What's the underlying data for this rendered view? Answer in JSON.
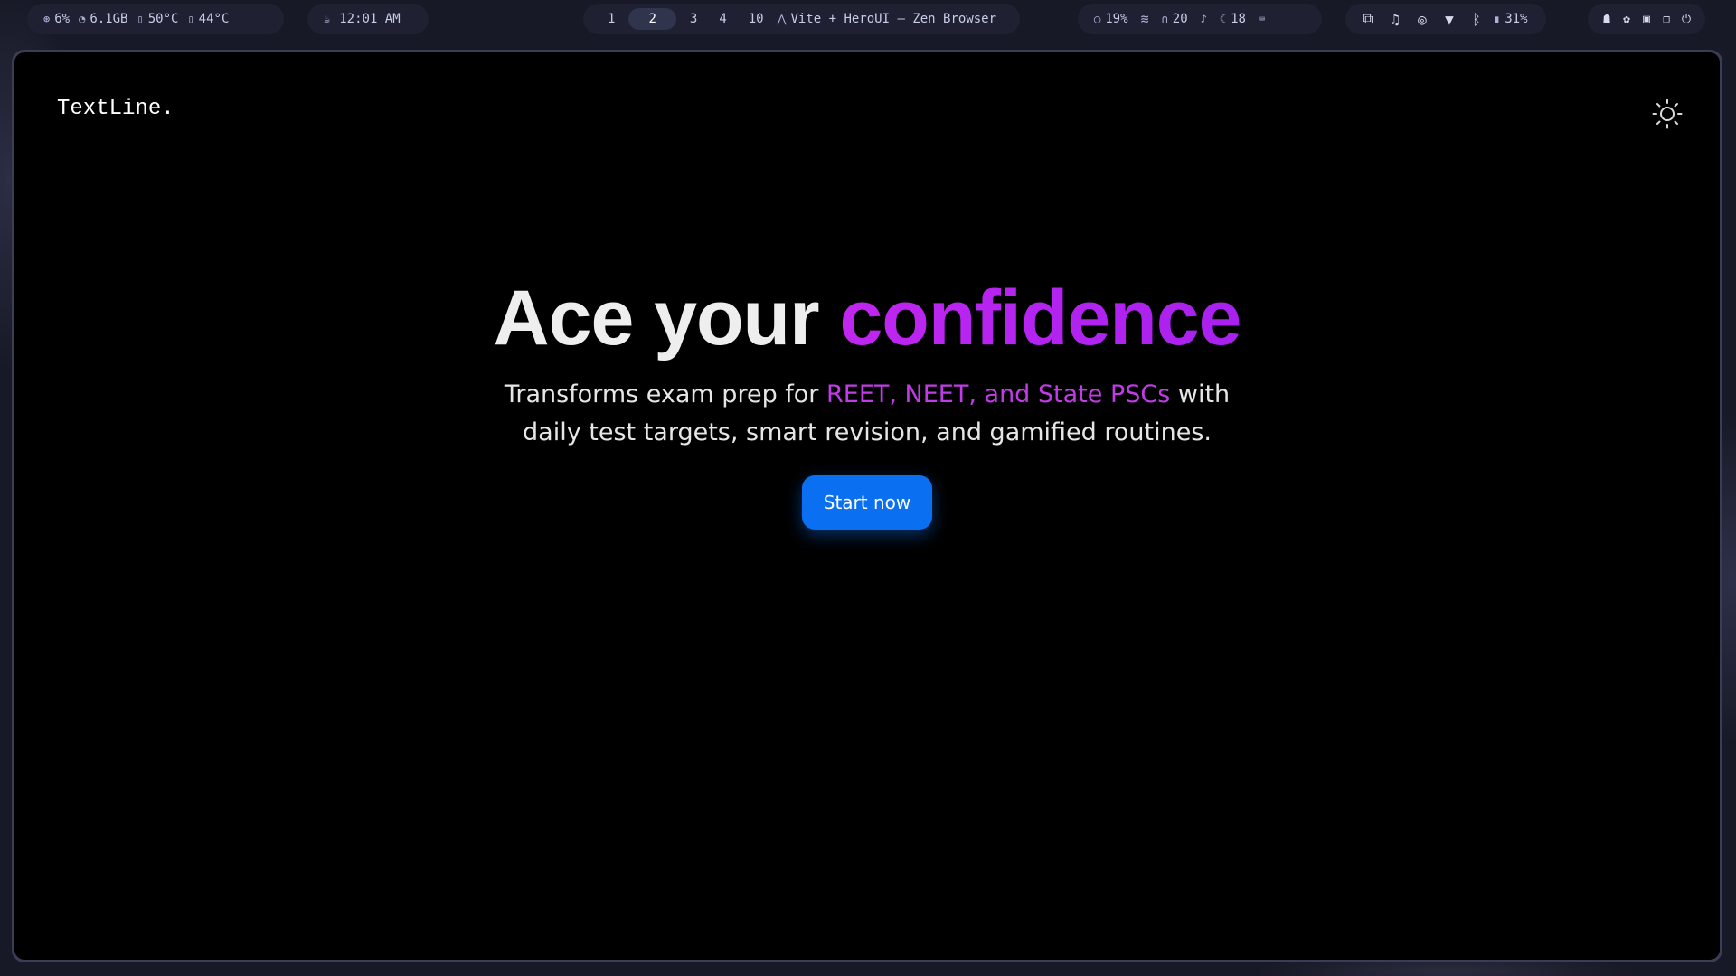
{
  "statusbar": {
    "stats": {
      "cpu": "6%",
      "memory": "6.1GB",
      "temp_cpu": "50°C",
      "temp_gpu": "44°C"
    },
    "clock": "12:01 AM",
    "workspaces": [
      "1",
      "2",
      "3",
      "4",
      "10"
    ],
    "active_workspace": "2",
    "window_title": "Vite + HeroUI — Zen Browser",
    "metrics": {
      "brightness": "19%",
      "headphones_volume": "20",
      "mic_level": "18"
    },
    "battery": "31%"
  },
  "app": {
    "logo": "TextLine.",
    "theme_toggle_icon": "sun-icon",
    "hero": {
      "headline_plain": "Ace your",
      "headline_accent": "confidence",
      "sub_before": "Transforms exam prep for",
      "sub_highlight": "REET, NEET, and State PSCs",
      "sub_after": "with daily test targets, smart revision, and gamified routines.",
      "cta_label": "Start now"
    },
    "colors": {
      "background": "#000000",
      "accent_purple": "#c026f0",
      "cta_blue": "#0a6ff0"
    }
  }
}
